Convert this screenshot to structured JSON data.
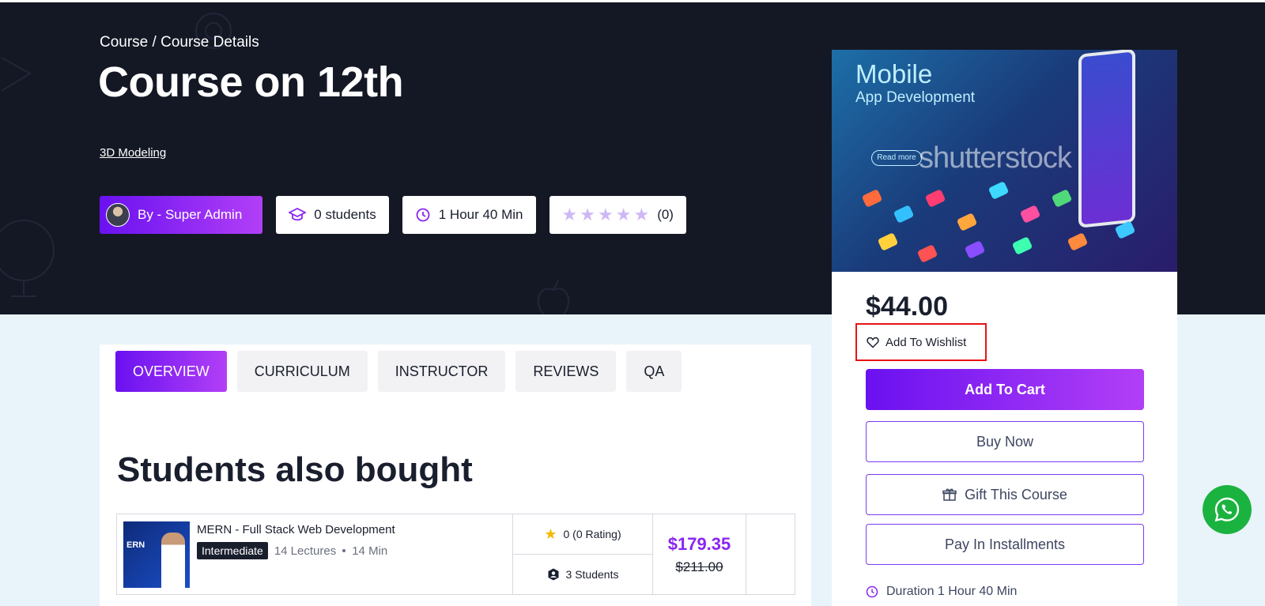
{
  "breadcrumb": {
    "root": "Course",
    "separator": " / ",
    "current": "Course Details"
  },
  "page_title": "Course on 12th",
  "category": "3D Modeling",
  "meta": {
    "author": "By - Super Admin",
    "students": "0 students",
    "duration": "1 Hour 40 Min",
    "rating_count": "(0)",
    "rating_value": 0,
    "rating_max": 5
  },
  "card": {
    "image": {
      "title": "Mobile",
      "subtitle": "App Development",
      "button": "Read more",
      "watermark": "shutterstock"
    },
    "price": "$44.00",
    "wishlist_label": "Add To Wishlist",
    "add_to_cart": "Add To Cart",
    "buy_now": "Buy Now",
    "gift": "Gift This Course",
    "installments": "Pay In Installments",
    "duration": "Duration 1 Hour 40 Min"
  },
  "tabs": [
    {
      "label": "OVERVIEW",
      "active": true
    },
    {
      "label": "CURRICULUM",
      "active": false
    },
    {
      "label": "INSTRUCTOR",
      "active": false
    },
    {
      "label": "REVIEWS",
      "active": false
    },
    {
      "label": "QA",
      "active": false
    }
  ],
  "also_bought": {
    "title": "Students also bought",
    "items": [
      {
        "thumb_text": "ERN",
        "title": "MERN - Full Stack Web Development",
        "level": "Intermediate",
        "lectures": "14 Lectures",
        "length": "14 Min",
        "rating": "0 (0 Rating)",
        "students": "3 Students",
        "price": "$179.35",
        "old_price": "$211.00"
      }
    ]
  },
  "colors": {
    "hero_bg": "#141824",
    "accent_start": "#6a11f0",
    "accent_end": "#b23ff7",
    "price_accent": "#8a25f2",
    "whatsapp": "#1bb33f",
    "highlight_box": "#e81414"
  },
  "icons": {
    "students": "graduation-cap-icon",
    "duration": "clock-history-icon",
    "wishlist": "heart-icon",
    "gift": "gift-icon",
    "rating": "star-icon",
    "students_small": "user-badge-icon",
    "chat": "whatsapp-icon"
  }
}
